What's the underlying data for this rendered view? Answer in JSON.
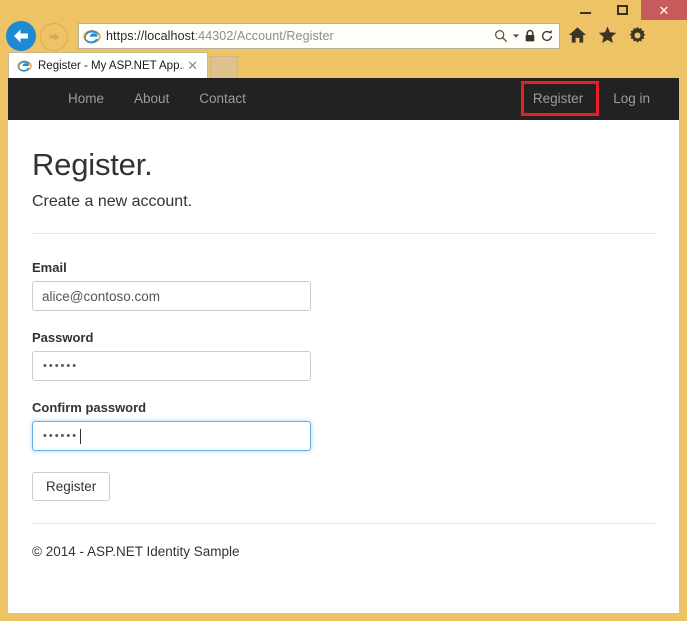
{
  "browser": {
    "window_controls": {
      "minimize": "minimize-icon",
      "maximize": "maximize-icon",
      "close": "✕"
    },
    "back_icon": "back-arrow-icon",
    "forward_icon": "forward-arrow-icon",
    "address": {
      "scheme": "https://",
      "host": "localhost",
      "port": ":44302",
      "path": "/Account/Register",
      "full_url": "https://localhost:44302/Account/Register",
      "search_icon": "search-icon",
      "dropdown_icon": "chevron-down-icon",
      "lock_icon": "lock-icon",
      "refresh_icon": "refresh-icon"
    },
    "toolbar_icons": [
      {
        "name": "home-icon",
        "glyph": "home"
      },
      {
        "name": "favorites-star-icon",
        "glyph": "star"
      },
      {
        "name": "settings-gear-icon",
        "glyph": "gear"
      }
    ],
    "tab": {
      "title": "Register - My ASP.NET App...",
      "close_label": "✕",
      "favicon": "internet-explorer-icon"
    },
    "new_tab_label": ""
  },
  "site_nav": {
    "left_links": [
      {
        "label": "Home"
      },
      {
        "label": "About"
      },
      {
        "label": "Contact"
      }
    ],
    "right_links": [
      {
        "label": "Register",
        "highlighted": true
      },
      {
        "label": "Log in",
        "highlighted": false
      }
    ],
    "highlight_color": "#ee1c25",
    "background_color": "#222222"
  },
  "page": {
    "title": "Register.",
    "subtitle": "Create a new account.",
    "form": {
      "email": {
        "label": "Email",
        "value": "alice@contoso.com",
        "placeholder": ""
      },
      "password": {
        "label": "Password",
        "value": "••••••",
        "masked_length": 6
      },
      "confirm_password": {
        "label": "Confirm password",
        "value": "••••••",
        "masked_length": 6,
        "focused": true
      },
      "submit_label": "Register"
    },
    "footer": "© 2014 - ASP.NET Identity Sample"
  }
}
